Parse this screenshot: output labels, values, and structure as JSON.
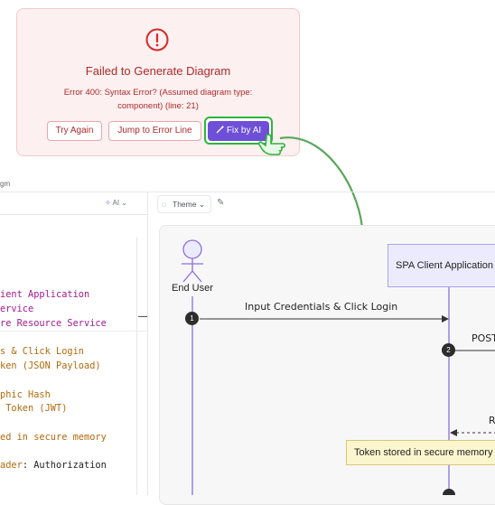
{
  "error_card": {
    "icon": "exclamation-circle-icon",
    "title": "Failed to Generate Diagram",
    "message_line1": "Error 400: Syntax Error? (Assumed diagram type:",
    "message_line2": "component) (line: 21)",
    "try_again_label": "Try Again",
    "jump_label": "Jump to Error Line",
    "fix_label": "Fix by AI"
  },
  "editor": {
    "breadcrumb": "gm",
    "ai_label": "AI",
    "theme_label": "Theme",
    "code_lines": [
      {
        "text": "ient Application",
        "color": "pur"
      },
      {
        "text": "ervice",
        "color": "pur"
      },
      {
        "text": "re Resource Service",
        "color": "pur"
      },
      {
        "text": "s & Click Login",
        "color": "org"
      },
      {
        "text": "ken (JSON Payload)",
        "color": "org"
      },
      {
        "text": "phic Hash",
        "color": "org"
      },
      {
        "text": " Token (JWT)",
        "color": "org"
      },
      {
        "text": "ed in secure memory",
        "color": "org"
      },
      {
        "text": "ader",
        "color": "org"
      },
      {
        "text": ": Authorization",
        "color": "blk"
      }
    ]
  },
  "diagram": {
    "actor_label": "End User",
    "participant_label": "SPA Client Application",
    "msg1_label": "Input Credentials & Click Login",
    "msg2_label": "POST",
    "msg3_label": "R",
    "note_label": "Token stored in secure memory",
    "step1": "1",
    "step2": "2"
  },
  "colors": {
    "error": "#b02a2a",
    "fix_button": "#6d4fd8",
    "highlight_green": "#2db53b",
    "lifeline": "#8b6fe0"
  }
}
